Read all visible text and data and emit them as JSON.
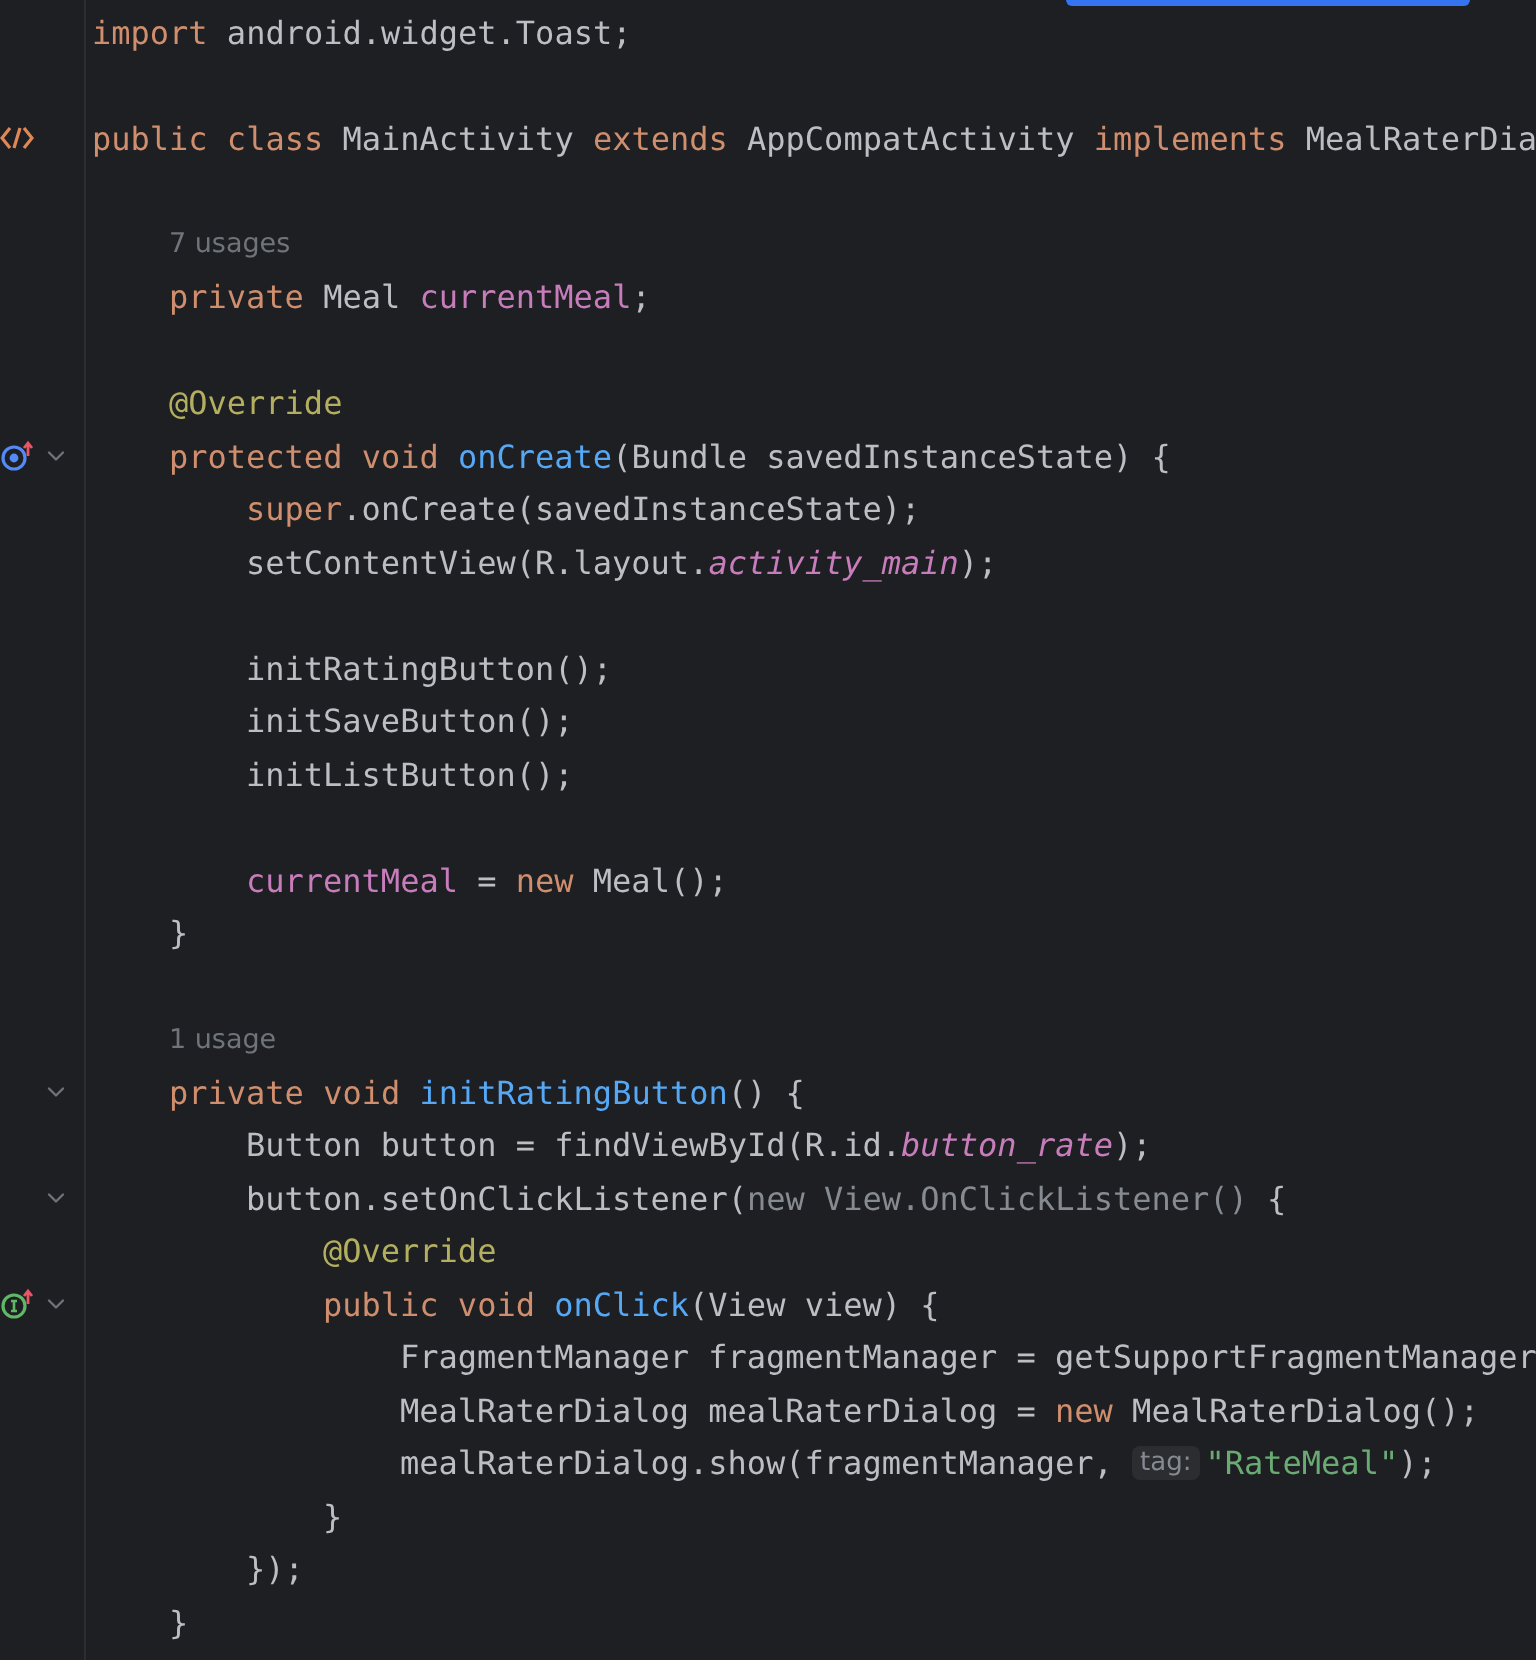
{
  "editor": {
    "lines": [
      {
        "kind": "code",
        "tokens": [
          {
            "kind": "keyword",
            "text": "import"
          },
          {
            "kind": "plain",
            "text": " android.widget.Toast;"
          }
        ]
      },
      {
        "kind": "blank"
      },
      {
        "kind": "code",
        "gutter": {
          "kind": "markup"
        },
        "tokens": [
          {
            "kind": "keyword",
            "text": "public class"
          },
          {
            "kind": "plain",
            "text": " MainActivity "
          },
          {
            "kind": "keyword",
            "text": "extends"
          },
          {
            "kind": "plain",
            "text": " AppCompatActivity "
          },
          {
            "kind": "keyword",
            "text": "implements"
          },
          {
            "kind": "plain",
            "text": " MealRaterDia"
          }
        ],
        "children": [
          {
            "kind": "blank"
          },
          {
            "kind": "usages",
            "text": "7 usages"
          },
          {
            "kind": "code",
            "tokens": [
              {
                "kind": "keyword",
                "text": "private"
              },
              {
                "kind": "plain",
                "text": " Meal "
              },
              {
                "kind": "field",
                "text": "currentMeal"
              },
              {
                "kind": "plain",
                "text": ";"
              }
            ]
          },
          {
            "kind": "blank"
          },
          {
            "kind": "code",
            "tokens": [
              {
                "kind": "annotation",
                "text": "@Override"
              }
            ]
          },
          {
            "kind": "code",
            "gutter": {
              "kind": "override"
            },
            "expanded": true,
            "tokens": [
              {
                "kind": "keyword",
                "text": "protected void "
              },
              {
                "kind": "method",
                "text": "onCreate"
              },
              {
                "kind": "plain",
                "text": "(Bundle savedInstanceState) {"
              }
            ],
            "children": [
              {
                "kind": "code",
                "tokens": [
                  {
                    "kind": "keyword",
                    "text": "super"
                  },
                  {
                    "kind": "plain",
                    "text": ".onCreate(savedInstanceState);"
                  }
                ]
              },
              {
                "kind": "code",
                "tokens": [
                  {
                    "kind": "plain",
                    "text": "setContentView(R.layout."
                  },
                  {
                    "kind": "static",
                    "text": "activity_main"
                  },
                  {
                    "kind": "plain",
                    "text": ");"
                  }
                ]
              },
              {
                "kind": "blank"
              },
              {
                "kind": "code",
                "tokens": [
                  {
                    "kind": "plain",
                    "text": "initRatingButton();"
                  }
                ]
              },
              {
                "kind": "code",
                "tokens": [
                  {
                    "kind": "plain",
                    "text": "initSaveButton();"
                  }
                ]
              },
              {
                "kind": "code",
                "tokens": [
                  {
                    "kind": "plain",
                    "text": "initListButton();"
                  }
                ]
              },
              {
                "kind": "blank"
              },
              {
                "kind": "code",
                "tokens": [
                  {
                    "kind": "field",
                    "text": "currentMeal"
                  },
                  {
                    "kind": "plain",
                    "text": " = "
                  },
                  {
                    "kind": "keyword",
                    "text": "new"
                  },
                  {
                    "kind": "plain",
                    "text": " Meal();"
                  }
                ]
              }
            ]
          },
          {
            "kind": "code",
            "tokens": [
              {
                "kind": "plain",
                "text": "}"
              }
            ]
          },
          {
            "kind": "blank"
          },
          {
            "kind": "usages",
            "text": "1 usage"
          },
          {
            "kind": "code",
            "expanded": true,
            "tokens": [
              {
                "kind": "keyword",
                "text": "private void "
              },
              {
                "kind": "method",
                "text": "initRatingButton"
              },
              {
                "kind": "plain",
                "text": "() {"
              }
            ],
            "children": [
              {
                "kind": "code",
                "tokens": [
                  {
                    "kind": "plain",
                    "text": "Button button = findViewById(R.id."
                  },
                  {
                    "kind": "static",
                    "text": "button_rate"
                  },
                  {
                    "kind": "plain",
                    "text": ");"
                  }
                ]
              },
              {
                "kind": "code",
                "expanded": true,
                "tokens": [
                  {
                    "kind": "plain",
                    "text": "button.setOnClickListener("
                  },
                  {
                    "kind": "dim",
                    "text": "new View.OnClickListener() "
                  },
                  {
                    "kind": "plain",
                    "text": "{"
                  }
                ],
                "children": [
                  {
                    "kind": "code",
                    "tokens": [
                      {
                        "kind": "annotation",
                        "text": "@Override"
                      }
                    ]
                  },
                  {
                    "kind": "code",
                    "gutter": {
                      "kind": "implement"
                    },
                    "expanded": true,
                    "tokens": [
                      {
                        "kind": "keyword",
                        "text": "public void "
                      },
                      {
                        "kind": "method",
                        "text": "onClick"
                      },
                      {
                        "kind": "plain",
                        "text": "(View view) {"
                      }
                    ],
                    "children": [
                      {
                        "kind": "code",
                        "tokens": [
                          {
                            "kind": "plain",
                            "text": "FragmentManager fragmentManager = getSupportFragmentManager"
                          }
                        ]
                      },
                      {
                        "kind": "code",
                        "tokens": [
                          {
                            "kind": "plain",
                            "text": "MealRaterDialog mealRaterDialog = "
                          },
                          {
                            "kind": "keyword",
                            "text": "new"
                          },
                          {
                            "kind": "plain",
                            "text": " MealRaterDialog();"
                          }
                        ]
                      },
                      {
                        "kind": "code",
                        "tokens": [
                          {
                            "kind": "plain",
                            "text": "mealRaterDialog.show(fragmentManager, "
                          },
                          {
                            "kind": "hint",
                            "text": "tag:"
                          },
                          {
                            "kind": "string",
                            "text": "\"RateMeal\""
                          },
                          {
                            "kind": "plain",
                            "text": ");"
                          }
                        ]
                      }
                    ]
                  },
                  {
                    "kind": "code",
                    "tokens": [
                      {
                        "kind": "plain",
                        "text": "}"
                      }
                    ]
                  }
                ]
              },
              {
                "kind": "code",
                "tokens": [
                  {
                    "kind": "plain",
                    "text": "});"
                  }
                ]
              }
            ]
          },
          {
            "kind": "code",
            "tokens": [
              {
                "kind": "plain",
                "text": "}"
              }
            ]
          }
        ]
      }
    ]
  }
}
